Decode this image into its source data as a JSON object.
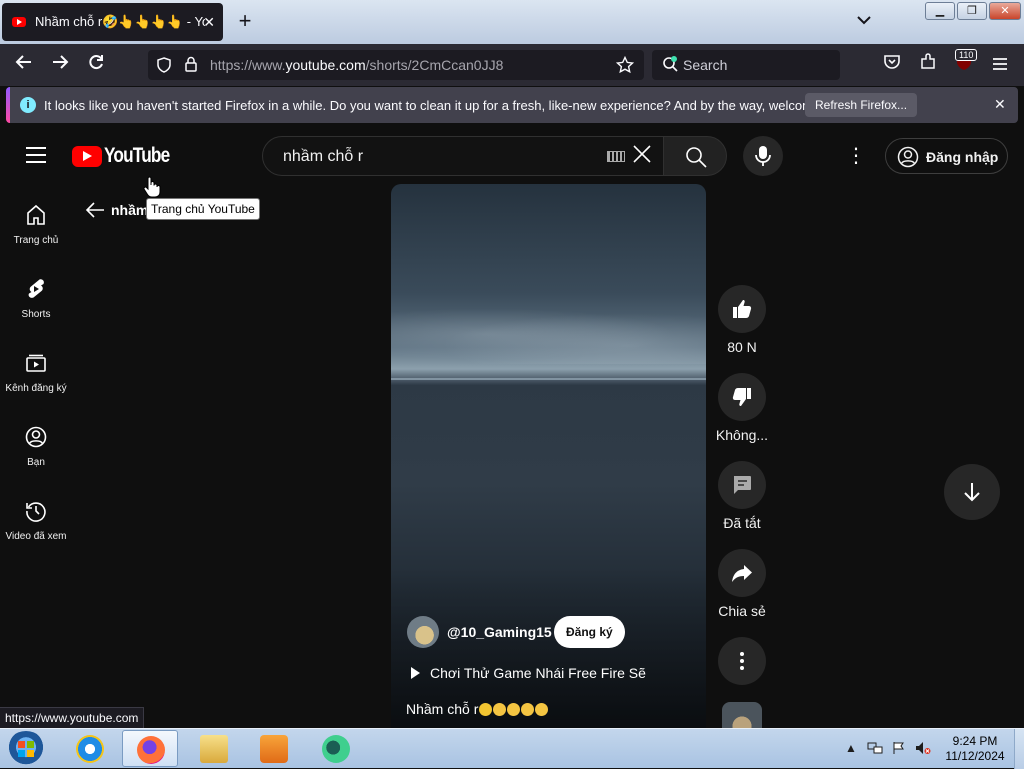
{
  "browser": {
    "tab_title": "Nhầm chỗ r🤣👆👆👆👆 - YouTube",
    "tab_close": "✕",
    "new_tab": "+",
    "url_prefix": "https://www.",
    "url_domain": "youtube.com",
    "url_path": "/shorts/2CmCcan0JJ8",
    "search_placeholder": "Search",
    "extensions_badge": "110",
    "status_url": "https://www.youtube.com"
  },
  "notification": {
    "info_glyph": "i",
    "message": "It looks like you haven't started Firefox in a while. Do you want to clean it up for a fresh, like-new experience? And by the way, welcome back!",
    "refresh_label": "Refresh Firefox...",
    "close_glyph": "✕"
  },
  "youtube": {
    "logo_text": "YouTube",
    "search_value": "nhầm chỗ r",
    "signin_label": "Đăng nhập",
    "more_glyph": "⋮",
    "guide": [
      {
        "label": "Trang chủ",
        "icon": "home-icon"
      },
      {
        "label": "Shorts",
        "icon": "shorts-icon"
      },
      {
        "label": "Kênh đăng ký",
        "icon": "subscriptions-icon"
      },
      {
        "label": "Bạn",
        "icon": "you-icon"
      },
      {
        "label": "Video đã xem",
        "icon": "history-icon"
      }
    ],
    "page_title": "nhầm",
    "tooltip": "Trang chủ YouTube",
    "short": {
      "channel": "@10_Gaming15",
      "subscribe_label": "Đăng ký",
      "playlist_title": "Chơi Thử Game Nhái Free Fire Sẽ",
      "caption": "Nhầm chỗ r"
    },
    "actions": {
      "like_count": "80 N",
      "dislike_label": "Không...",
      "comments_label": "Đã tắt",
      "share_label": "Chia sẻ"
    }
  },
  "taskbar": {
    "time": "9:24 PM",
    "date": "11/12/2024",
    "show_hidden": "▲"
  },
  "colors": {
    "yt_red": "#ff0000",
    "yt_bg": "#0f0f0f",
    "firefox_chrome": "#2b2a33"
  }
}
